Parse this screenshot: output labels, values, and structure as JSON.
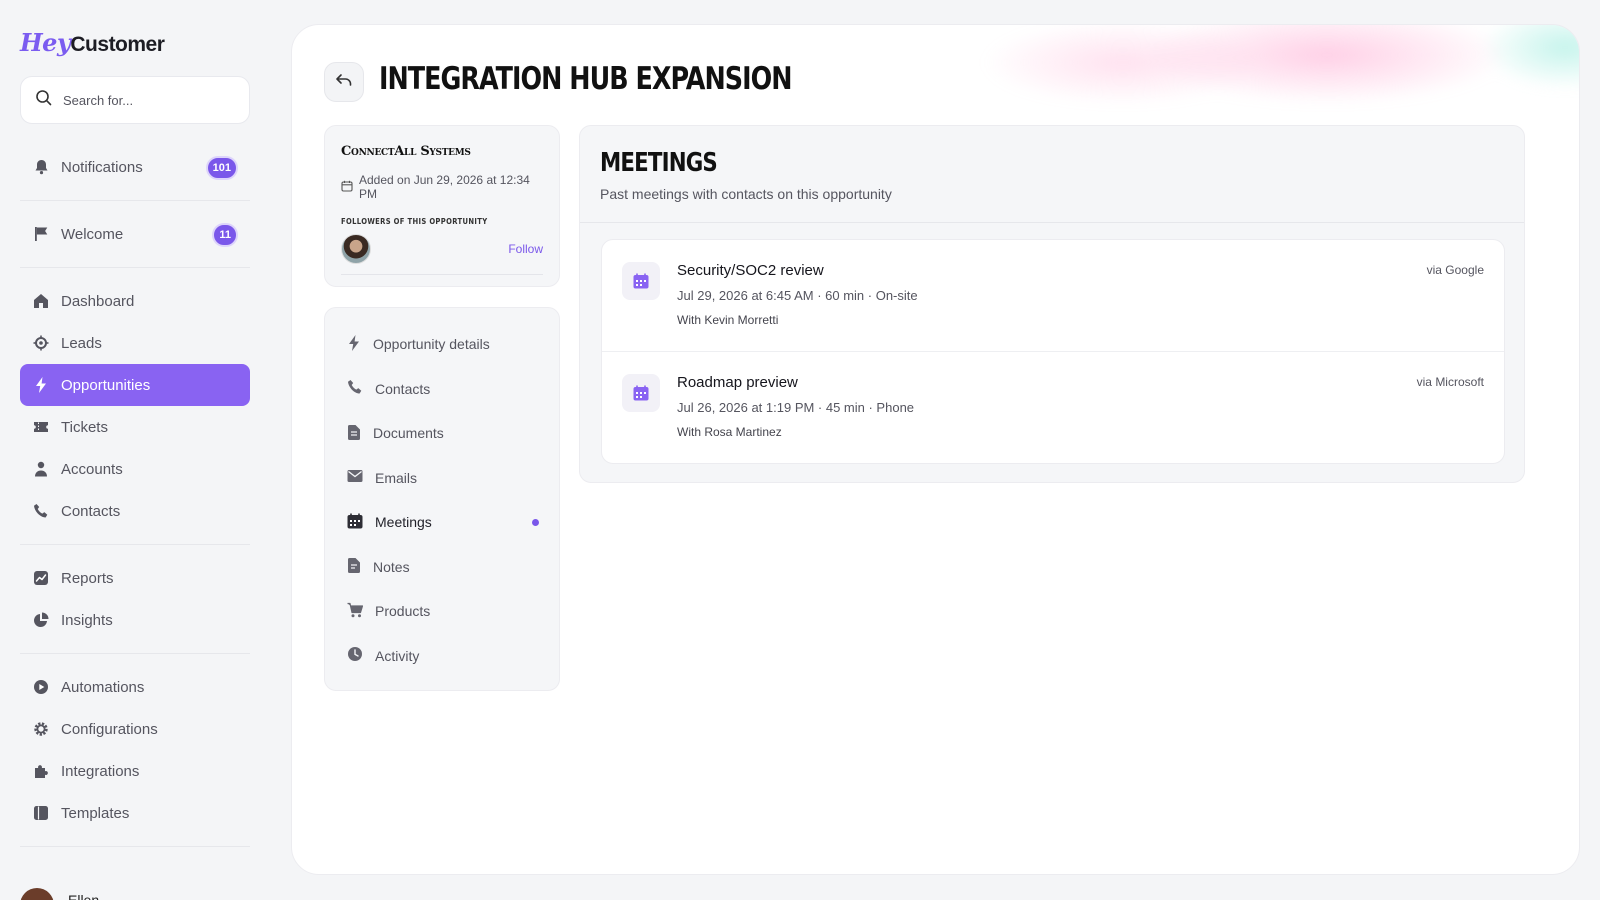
{
  "brand": {
    "logo_part1": "Hey",
    "logo_part2": "Customer",
    "accent_color": "#8963f2"
  },
  "search": {
    "placeholder": "Search for..."
  },
  "sidebar": {
    "top_items": [
      {
        "label": "Notifications",
        "icon": "bell-icon",
        "badge": "101"
      },
      {
        "label": "Welcome",
        "icon": "flag-icon",
        "badge": "11"
      }
    ],
    "main_items": [
      {
        "label": "Dashboard",
        "icon": "home-icon"
      },
      {
        "label": "Leads",
        "icon": "target-icon"
      },
      {
        "label": "Opportunities",
        "icon": "bolt-icon",
        "active": true
      },
      {
        "label": "Tickets",
        "icon": "ticket-icon"
      },
      {
        "label": "Accounts",
        "icon": "person-icon"
      },
      {
        "label": "Contacts",
        "icon": "phone-icon"
      }
    ],
    "report_items": [
      {
        "label": "Reports",
        "icon": "chart-icon"
      },
      {
        "label": "Insights",
        "icon": "pie-icon"
      }
    ],
    "setting_items": [
      {
        "label": "Automations",
        "icon": "play-icon"
      },
      {
        "label": "Configurations",
        "icon": "gear-icon"
      },
      {
        "label": "Integrations",
        "icon": "puzzle-icon"
      },
      {
        "label": "Templates",
        "icon": "template-icon"
      }
    ],
    "user_name": "Ellen"
  },
  "page": {
    "title": "INTEGRATION HUB EXPANSION"
  },
  "company": {
    "name": "ConnectAll Systems",
    "added": "Added on Jun 29, 2026 at 12:34 PM",
    "followers_label": "Followers of this opportunity",
    "follow_label": "Follow"
  },
  "subnav": {
    "items": [
      {
        "label": "Opportunity details",
        "icon": "bolt-icon"
      },
      {
        "label": "Contacts",
        "icon": "phone-icon"
      },
      {
        "label": "Documents",
        "icon": "document-icon"
      },
      {
        "label": "Emails",
        "icon": "mail-icon"
      },
      {
        "label": "Meetings",
        "icon": "calendar-icon",
        "active": true
      },
      {
        "label": "Notes",
        "icon": "note-icon"
      },
      {
        "label": "Products",
        "icon": "cart-icon"
      },
      {
        "label": "Activity",
        "icon": "clock-icon"
      }
    ]
  },
  "meetings": {
    "title": "MEETINGS",
    "subtitle": "Past meetings with contacts on this opportunity",
    "items": [
      {
        "title": "Security/SOC2 review",
        "meta": "Jul 29, 2026 at 6:45 AM · 60 min · On-site",
        "with": "With Kevin Morretti",
        "source": "via Google"
      },
      {
        "title": "Roadmap preview",
        "meta": "Jul 26, 2026 at 1:19 PM · 45 min · Phone",
        "with": "With Rosa Martinez",
        "source": "via Microsoft"
      }
    ]
  }
}
